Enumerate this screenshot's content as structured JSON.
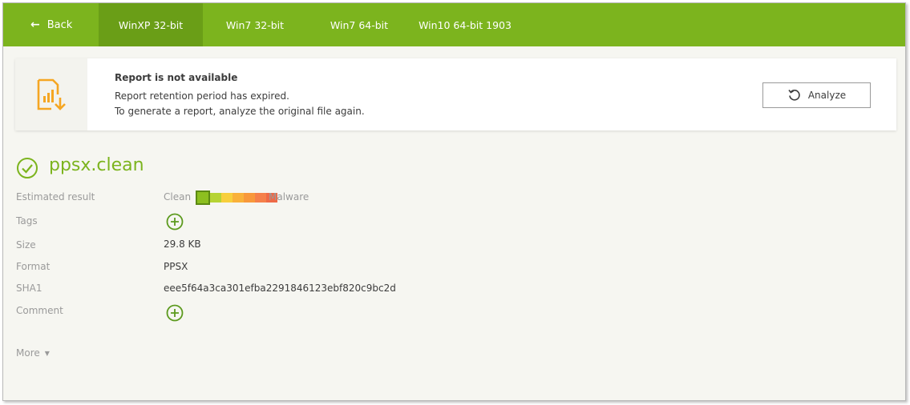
{
  "nav": {
    "back_label": "Back",
    "tabs": [
      {
        "label": "WinXP 32-bit",
        "active": true
      },
      {
        "label": "Win7 32-bit",
        "active": false
      },
      {
        "label": "Win7 64-bit",
        "active": false
      },
      {
        "label": "Win10 64-bit 1903",
        "active": false
      }
    ]
  },
  "notice": {
    "icon": "report-download-icon",
    "title": "Report is not available",
    "line1": "Report retention period has expired.",
    "line2": "To generate a report, analyze the original file again.",
    "analyze_label": "Analyze"
  },
  "file": {
    "name": "ppsx.clean",
    "status_icon": "check-circle-icon",
    "estimated_result_label": "Estimated result",
    "scale": {
      "left_label": "Clean",
      "right_label": "Malware",
      "colors": [
        "#8cbf1f",
        "#b6d334",
        "#f7cf3c",
        "#f9b13a",
        "#f8983b",
        "#f5804a",
        "#ee6a47"
      ],
      "selected_index": 0
    },
    "tags_label": "Tags",
    "size_label": "Size",
    "size_value": "29.8 KB",
    "format_label": "Format",
    "format_value": "PPSX",
    "sha1_label": "SHA1",
    "sha1_value": "eee5f64a3ca301efba2291846123ebf820c9bc2d",
    "comment_label": "Comment",
    "more_label": "More"
  },
  "colors": {
    "accent": "#7cb41e",
    "accent_dark": "#6a9e17",
    "warning_icon": "#f5a623"
  }
}
